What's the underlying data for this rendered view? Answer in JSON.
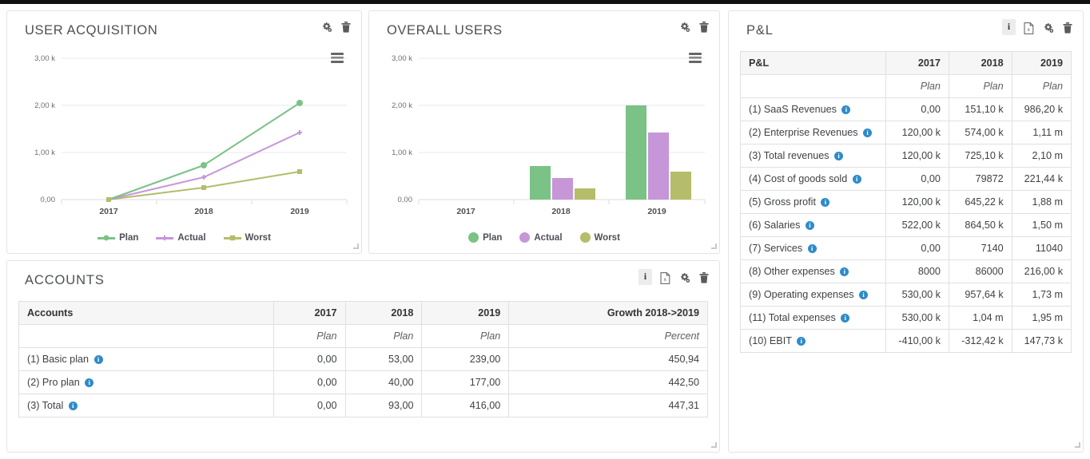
{
  "theme": {
    "plan_color": "#7bc286",
    "actual_color": "#c696d8",
    "worst_color": "#b5bc6a",
    "info_color": "#2e8bc9",
    "panel_border": "#e3e3e3",
    "header_bg": "#f6f6f6"
  },
  "panels": {
    "user_acquisition": {
      "title": "USER ACQUISITION",
      "icons": [
        "gear-icon",
        "trash-icon"
      ],
      "menu_icon": "hamburger-menu-icon"
    },
    "overall_users": {
      "title": "OVERALL USERS",
      "icons": [
        "gear-icon",
        "trash-icon"
      ],
      "menu_icon": "hamburger-menu-icon"
    },
    "pl": {
      "title": "P&L",
      "icons": [
        "info-icon",
        "export-xls-icon",
        "gear-icon",
        "trash-icon"
      ]
    },
    "accounts": {
      "title": "ACCOUNTS",
      "icons": [
        "info-icon",
        "export-xls-icon",
        "gear-icon",
        "trash-icon"
      ]
    }
  },
  "chart_data": [
    {
      "type": "line",
      "title": "USER ACQUISITION",
      "categories": [
        "2017",
        "2018",
        "2019"
      ],
      "x": [
        2017,
        2018,
        2019
      ],
      "series": [
        {
          "name": "Plan",
          "values": [
            0,
            720,
            2060
          ],
          "color": "#7bc286",
          "marker": "circle"
        },
        {
          "name": "Actual",
          "values": [
            0,
            470,
            1420
          ],
          "color": "#c696d8",
          "marker": "plus"
        },
        {
          "name": "Worst",
          "values": [
            0,
            250,
            600
          ],
          "color": "#b5bc6a",
          "marker": "square"
        }
      ],
      "ylim": [
        0,
        3000
      ],
      "yticks": [
        0,
        1000,
        2000,
        3000
      ],
      "ytick_labels": [
        "0,00",
        "1,00 k",
        "2,00 k",
        "3,00 k"
      ],
      "xlabel": "",
      "ylabel": "",
      "grid": true,
      "legend_position": "bottom"
    },
    {
      "type": "bar",
      "title": "OVERALL USERS",
      "categories": [
        "2017",
        "2018",
        "2019"
      ],
      "series": [
        {
          "name": "Plan",
          "values": [
            0,
            720,
            2000
          ],
          "color": "#7bc286"
        },
        {
          "name": "Actual",
          "values": [
            0,
            470,
            1420
          ],
          "color": "#c696d8"
        },
        {
          "name": "Worst",
          "values": [
            0,
            250,
            600
          ],
          "color": "#b5bc6a"
        }
      ],
      "ylim": [
        0,
        3000
      ],
      "yticks": [
        0,
        1000,
        2000,
        3000
      ],
      "ytick_labels": [
        "0,00",
        "1,00 k",
        "2,00 k",
        "3,00 k"
      ],
      "xlabel": "",
      "ylabel": "",
      "grid": true,
      "legend_position": "bottom"
    }
  ],
  "pl_table": {
    "headers": [
      "P&L",
      "2017",
      "2018",
      "2019"
    ],
    "units": [
      "",
      "Plan",
      "Plan",
      "Plan"
    ],
    "rows": [
      {
        "label": "(1) SaaS Revenues",
        "values": [
          "0,00",
          "151,10 k",
          "986,20 k"
        ]
      },
      {
        "label": "(2) Enterprise Revenues",
        "values": [
          "120,00 k",
          "574,00 k",
          "1,11 m"
        ]
      },
      {
        "label": "(3) Total revenues",
        "values": [
          "120,00 k",
          "725,10 k",
          "2,10 m"
        ]
      },
      {
        "label": "(4) Cost of goods sold",
        "values": [
          "0,00",
          "79872",
          "221,44 k"
        ]
      },
      {
        "label": "(5) Gross profit",
        "values": [
          "120,00 k",
          "645,22 k",
          "1,88 m"
        ]
      },
      {
        "label": "(6) Salaries",
        "values": [
          "522,00 k",
          "864,50 k",
          "1,50 m"
        ]
      },
      {
        "label": "(7) Services",
        "values": [
          "0,00",
          "7140",
          "11040"
        ]
      },
      {
        "label": "(8) Other expenses",
        "values": [
          "8000",
          "86000",
          "216,00 k"
        ]
      },
      {
        "label": "(9) Operating expenses",
        "values": [
          "530,00 k",
          "957,64 k",
          "1,73 m"
        ]
      },
      {
        "label": "(11) Total expenses",
        "values": [
          "530,00 k",
          "1,04 m",
          "1,95 m"
        ]
      },
      {
        "label": "(10) EBIT",
        "values": [
          "-410,00 k",
          "-312,42 k",
          "147,73 k"
        ]
      }
    ]
  },
  "accounts_table": {
    "headers": [
      "Accounts",
      "2017",
      "2018",
      "2019",
      "Growth 2018->2019"
    ],
    "units": [
      "",
      "Plan",
      "Plan",
      "Plan",
      "Percent"
    ],
    "rows": [
      {
        "label": "(1) Basic plan",
        "values": [
          "0,00",
          "53,00",
          "239,00",
          "450,94"
        ]
      },
      {
        "label": "(2) Pro plan",
        "values": [
          "0,00",
          "40,00",
          "177,00",
          "442,50"
        ]
      },
      {
        "label": "(3) Total",
        "values": [
          "0,00",
          "93,00",
          "416,00",
          "447,31"
        ]
      }
    ]
  }
}
